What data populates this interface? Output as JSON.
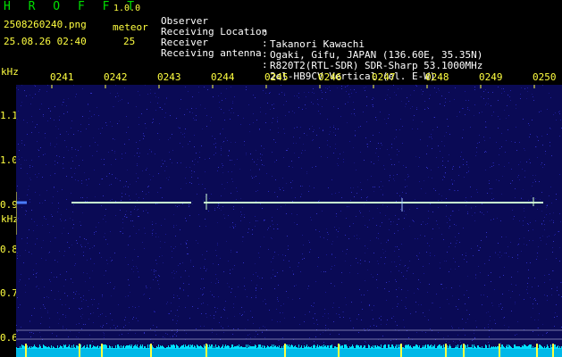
{
  "header": {
    "app_title": "H R O F F T",
    "app_version": "1.0.0",
    "filename": "2508260240.png",
    "meteor_label": "meteor",
    "datetime": "25.08.26 02:40",
    "meteor_count": "25"
  },
  "info": [
    {
      "key": "Observer",
      "sep": ":",
      "value": "Takanori Kawachi"
    },
    {
      "key": "Receiving Location",
      "sep": ":",
      "value": "Ogaki, Gifu, JAPAN (136.60E, 35.35N)"
    },
    {
      "key": "Receiver",
      "sep": ":",
      "value": "R820T2(RTL-SDR) SDR-Sharp 53.1000MHz"
    },
    {
      "key": "Receiving antenna",
      "sep": ":",
      "value": "2el-HB9CV Vertical (el. E-W)"
    }
  ],
  "axis": {
    "unit_top": "kHz",
    "unit_bottom": "kHz",
    "time_ticks": [
      "0241",
      "0242",
      "0243",
      "0244",
      "0245",
      "0246",
      "0247",
      "0248",
      "0249",
      "0250"
    ],
    "freq_ticks": [
      "1.1",
      "1.0",
      "0.9",
      "0.8",
      "0.7",
      "0.6"
    ]
  },
  "colors": {
    "background": "#000000",
    "label_yellow": "#ffff40",
    "plot_bg": "#0a0a55",
    "signal": "#c8ffd0",
    "bottom_band": "#00e0ff",
    "bottom_peaks": "#ffff40"
  }
}
